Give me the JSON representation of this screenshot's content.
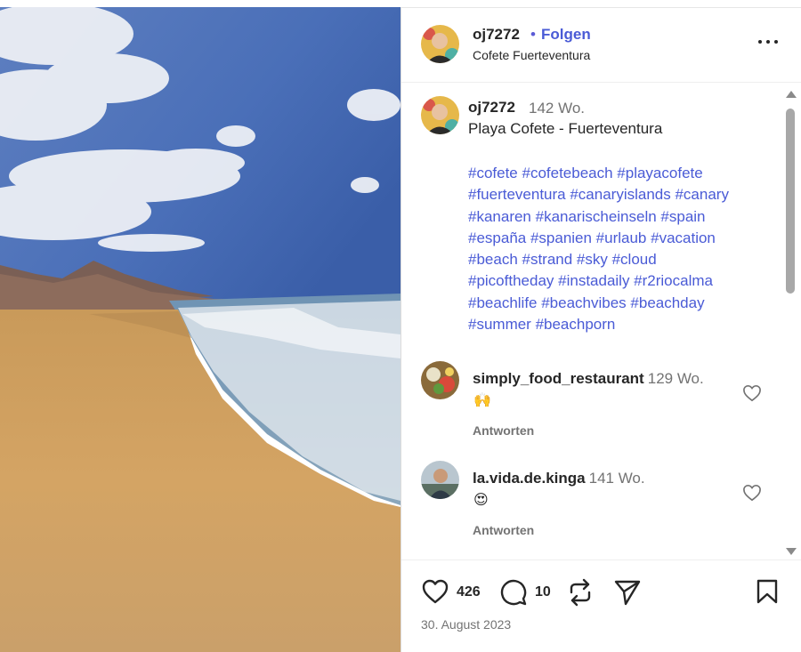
{
  "post": {
    "username": "oj7272",
    "dot": "•",
    "follow_label": "Folgen",
    "location": "Cofete Fuerteventura",
    "more_icon": "more-horizontal-icon"
  },
  "caption": {
    "username": "oj7272",
    "time": "142 Wo.",
    "title": "Playa Cofete - Fuerteventura",
    "hashtag_lines": [
      "#cofete #cofetebeach #playacofete",
      "#fuerteventura #canaryislands #canary",
      "#kanaren #kanarischeinseln #spain",
      "#españa #spanien #urlaub #vacation",
      "#beach #strand #sky #cloud",
      "#picoftheday #instadaily #r2riocalma",
      "#beachlife #beachvibes #beachday",
      "#summer #beachporn"
    ]
  },
  "comments": [
    {
      "username": "simply_food_restaurant",
      "time": "129 Wo.",
      "emoji": "🙌",
      "reply_label": "Antworten"
    },
    {
      "username": "la.vida.de.kinga",
      "time": "141 Wo.",
      "emoji": "😍",
      "reply_label": "Antworten"
    }
  ],
  "actions": {
    "likes": "426",
    "comments": "10",
    "date": "30. August 2023"
  },
  "colors": {
    "link": "#4a5bd6",
    "muted": "#737373",
    "text": "#262626"
  }
}
